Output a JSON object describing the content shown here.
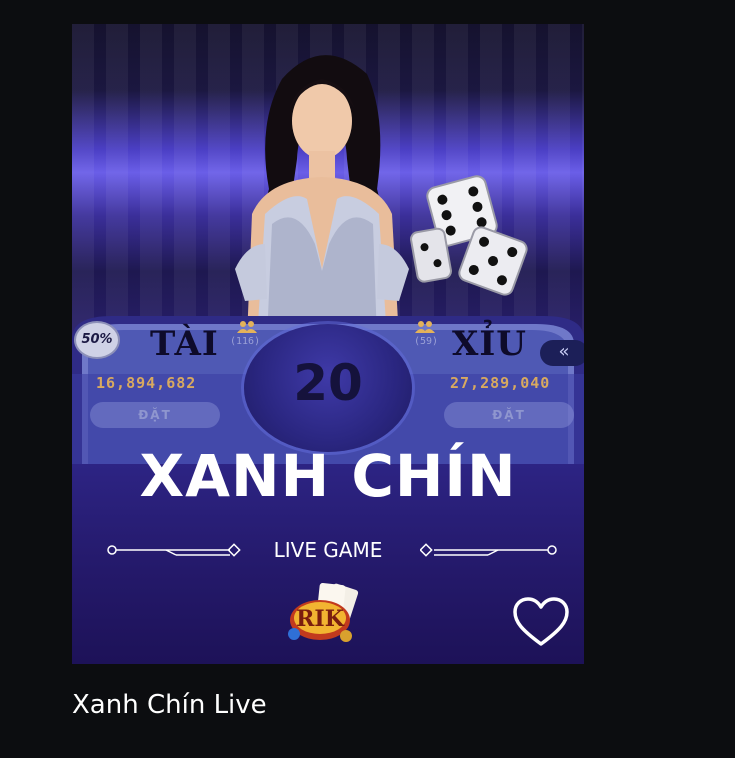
{
  "card": {
    "badge": "50%",
    "left_side": {
      "label": "TÀI",
      "count": "(116)",
      "amount": "16,894,682",
      "button": "ĐẶT"
    },
    "right_side": {
      "label": "XỈU",
      "count": "(59)",
      "amount": "27,289,040",
      "button": "ĐẶT"
    },
    "center_number": "20",
    "arrow_symbol": "«",
    "title": "XANH CHÍN",
    "subtitle": "LIVE GAME",
    "logo_text": "RIK",
    "favorite_icon": "heart-icon"
  },
  "game": {
    "name": "Xanh Chín Live"
  },
  "colors": {
    "page_bg": "#0c0d10",
    "accent_gold": "#d8a960",
    "card_purple": "#2d2484"
  }
}
